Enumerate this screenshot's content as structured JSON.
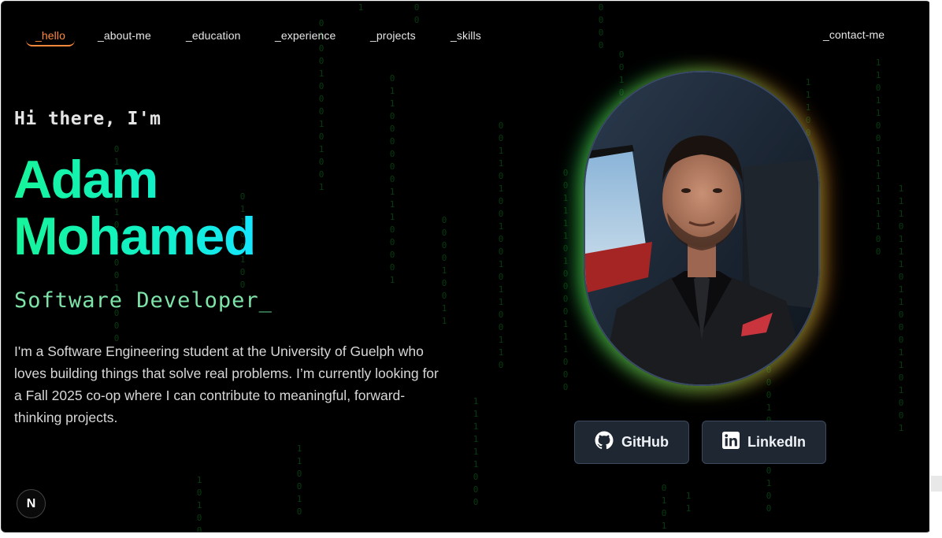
{
  "nav": {
    "items": [
      {
        "label": "_hello",
        "active": true
      },
      {
        "label": "_about-me",
        "active": false
      },
      {
        "label": "_education",
        "active": false
      },
      {
        "label": "_experience",
        "active": false
      },
      {
        "label": "_projects",
        "active": false
      },
      {
        "label": "_skills",
        "active": false
      }
    ],
    "contact_label": "_contact-me"
  },
  "hero": {
    "greeting": "Hi there, I'm",
    "first_name": "Adam",
    "last_name": "Mohamed",
    "role": "Software Developer",
    "cursor": "_",
    "bio": "I'm a Software Engineering student at the University of Guelph who loves building things that solve real problems. I’m currently looking for a Fall 2025 co-op where I can contribute to meaningful, forward-thinking projects."
  },
  "social": {
    "github_label": "GitHub",
    "linkedin_label": "LinkedIn"
  },
  "badge": {
    "letter": "N"
  },
  "icons": {
    "github": "github-icon",
    "linkedin": "linkedin-icon",
    "profile": "profile-photo"
  },
  "colors": {
    "accent": "#ff8a3d",
    "name_gradient_start": "#16f59a",
    "name_gradient_end": "#14e6ff",
    "role": "#7de3a8",
    "rain": "#0b6b1c",
    "button_bg": "#1f2733"
  }
}
